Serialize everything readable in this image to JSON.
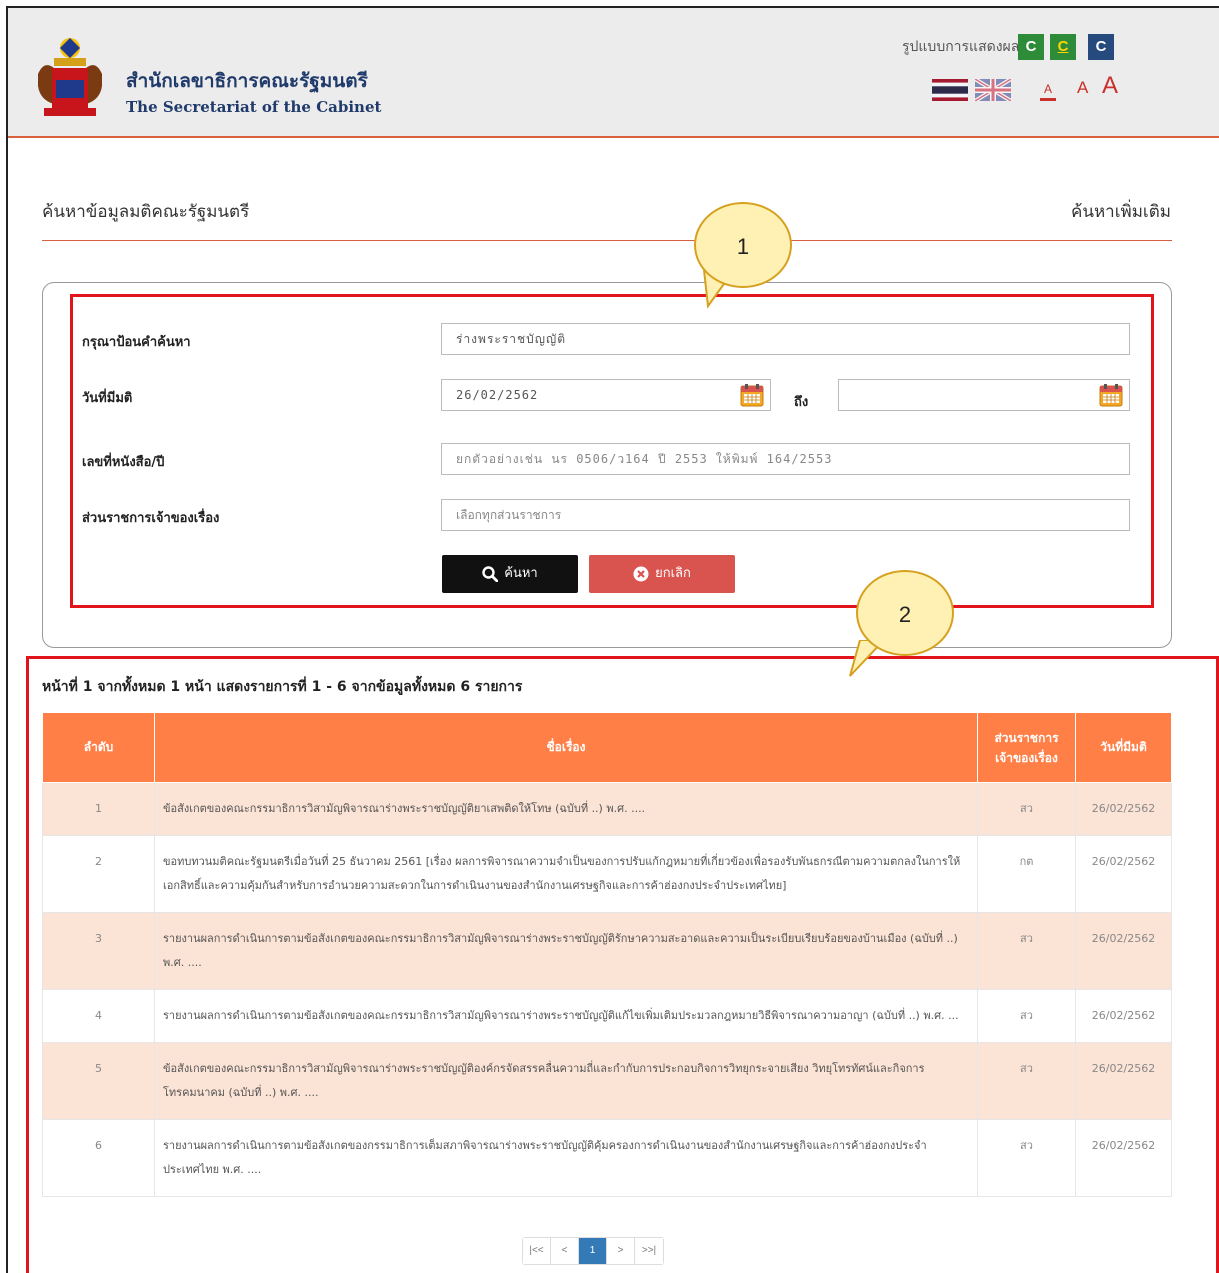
{
  "header": {
    "title_th": "สำนักเลขาธิการคณะรัฐมนตรี",
    "title_en": "The Secretariat of the Cabinet",
    "display_label": "รูปแบบการแสดงผล |",
    "contrast_options": [
      "C",
      "C",
      "C"
    ],
    "font_size_options": [
      "A",
      "A",
      "A"
    ],
    "accent": "#d9603f"
  },
  "page": {
    "title": "ค้นหาข้อมูลมติคณะรัฐมนตรี",
    "more_search": "ค้นหาเพิ่มเติม"
  },
  "callouts": [
    "1",
    "2"
  ],
  "search_form": {
    "keyword_label": "กรุณาป้อนคำค้นหา",
    "keyword_value": "ร่างพระราชบัญญัติ",
    "date_label": "วันที่มีมติ",
    "date_from_value": "26/02/2562",
    "date_to_label": "ถึง",
    "date_to_value": "",
    "doc_no_label": "เลขที่หนังสือ/ปี",
    "doc_no_placeholder": "ยกตัวอย่างเช่น นร 0506/ว164 ปี 2553 ให้พิมพ์ 164/2553",
    "agency_label": "ส่วนราชการเจ้าของเรื่อง",
    "agency_placeholder": "เลือกทุกส่วนราชการ",
    "search_button": "ค้นหา",
    "cancel_button": "ยกเลิก"
  },
  "results": {
    "summary": "หน้าที่ 1 จากทั้งหมด 1 หน้า แสดงรายการที่ 1 - 6 จากข้อมูลทั้งหมด 6 รายการ",
    "headers": {
      "no": "ลำดับ",
      "subject": "ชื่อเรื่อง",
      "agency_line1": "ส่วนราชการ",
      "agency_line2": "เจ้าของเรื่อง",
      "date": "วันที่มีมติ"
    },
    "rows": [
      {
        "no": "1",
        "subject": "ข้อสังเกตของคณะกรรมาธิการวิสามัญพิจารณาร่างพระราชบัญญัติยาเสพติดให้โทษ (ฉบับที่ ..) พ.ศ. ....",
        "agency": "สว",
        "date": "26/02/2562"
      },
      {
        "no": "2",
        "subject": "ขอทบทวนมติคณะรัฐมนตรีเมื่อวันที่ 25 ธันวาคม 2561 [เรื่อง ผลการพิจารณาความจำเป็นของการปรับแก้กฎหมายที่เกี่ยวข้องเพื่อรองรับพันธกรณีตามความตกลงในการให้เอกสิทธิ์และความคุ้มกันสำหรับการอำนวยความสะดวกในการดำเนินงานของสำนักงานเศรษฐกิจและการค้าฮ่องกงประจำประเทศไทย]",
        "agency": "กต",
        "date": "26/02/2562"
      },
      {
        "no": "3",
        "subject": "รายงานผลการดำเนินการตามข้อสังเกตของคณะกรรมาธิการวิสามัญพิจารณาร่างพระราชบัญญัติรักษาความสะอาดและความเป็นระเบียบเรียบร้อยของบ้านเมือง (ฉบับที่ ..) พ.ศ. ....",
        "agency": "สว",
        "date": "26/02/2562"
      },
      {
        "no": "4",
        "subject": "รายงานผลการดำเนินการตามข้อสังเกตของคณะกรรมาธิการวิสามัญพิจารณาร่างพระราชบัญญัติแก้ไขเพิ่มเติมประมวลกฎหมายวิธีพิจารณาความอาญา (ฉบับที่ ..) พ.ศ. ...",
        "agency": "สว",
        "date": "26/02/2562"
      },
      {
        "no": "5",
        "subject": "ข้อสังเกตของคณะกรรมาธิการวิสามัญพิจารณาร่างพระราชบัญญัติองค์กรจัดสรรคลื่นความถี่และกำกับการประกอบกิจการวิทยุกระจายเสียง วิทยุโทรทัศน์และกิจการโทรคมนาคม (ฉบับที่ ..) พ.ศ. ....",
        "agency": "สว",
        "date": "26/02/2562"
      },
      {
        "no": "6",
        "subject": "รายงานผลการดำเนินการตามข้อสังเกตของกรรมาธิการเต็มสภาพิจารณาร่างพระราชบัญญัติคุ้มครองการดำเนินงานของสำนักงานเศรษฐกิจและการค้าฮ่องกงประจำประเทศไทย พ.ศ. ....",
        "agency": "สว",
        "date": "26/02/2562"
      }
    ]
  },
  "pagination": {
    "first": "|<<",
    "prev": "<",
    "current": "1",
    "next": ">",
    "last": ">>|"
  }
}
